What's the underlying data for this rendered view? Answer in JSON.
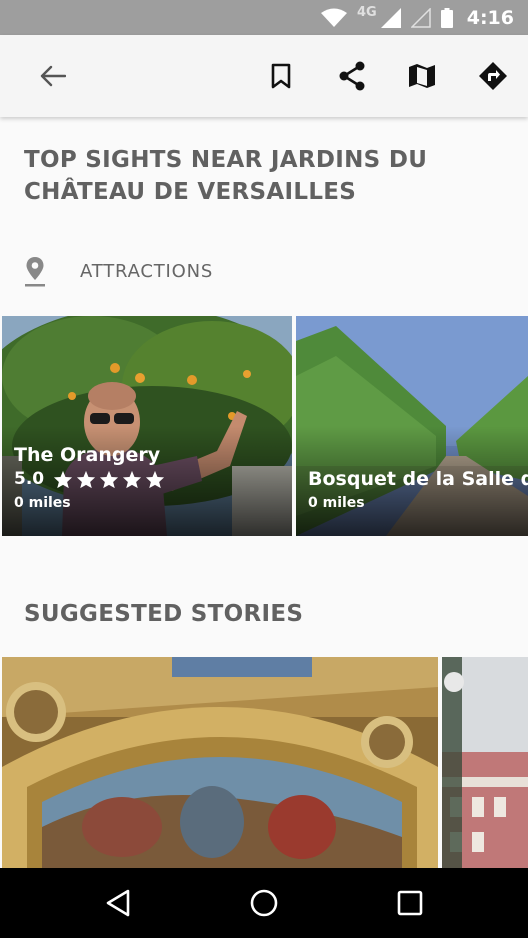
{
  "status_bar": {
    "network": "4G",
    "time": "4:16"
  },
  "app_bar": {
    "icons": [
      "back-arrow-icon",
      "bookmark-icon",
      "share-icon",
      "map-icon",
      "directions-icon"
    ]
  },
  "header": {
    "title_line1": "TOP SIGHTS NEAR JARDINS DU",
    "title_line2": "CHÂTEAU DE VERSAILLES"
  },
  "category": {
    "label": "ATTRACTIONS",
    "icon": "location-pin-icon"
  },
  "sights": [
    {
      "name": "The Orangery",
      "rating": "5.0",
      "stars": 5,
      "distance": "0 miles"
    },
    {
      "name": "Bosquet de la Salle d",
      "distance": "0 miles"
    }
  ],
  "stories": {
    "title": "SUGGESTED STORIES"
  },
  "nav_bar": {
    "icons": [
      "back-triangle-icon",
      "home-circle-icon",
      "recents-square-icon"
    ]
  }
}
